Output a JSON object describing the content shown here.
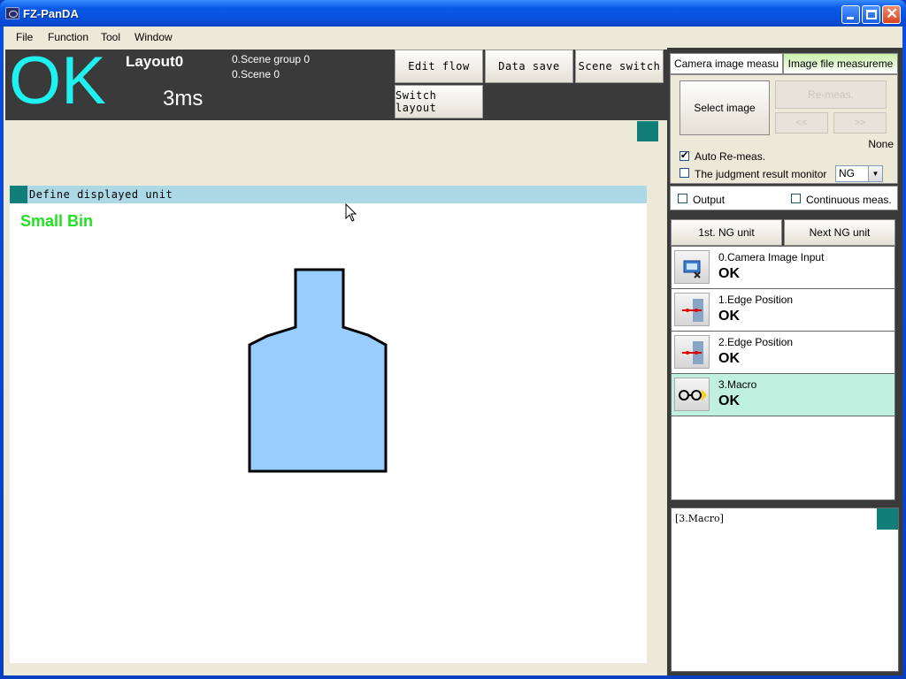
{
  "window": {
    "title": "FZ-PanDA"
  },
  "menu": [
    "File",
    "Function",
    "Tool",
    "Window"
  ],
  "header": {
    "judgement": "OK",
    "layout_name": "Layout0",
    "processing_time": "3ms",
    "scene_group": "0.Scene group 0",
    "scene": "0.Scene 0",
    "buttons": {
      "edit_flow": "Edit flow",
      "data_save": "Data save",
      "scene_switch": "Scene switch",
      "switch_layout": "Switch layout"
    }
  },
  "image_area": {
    "unit_bar_label": "Define displayed unit",
    "canvas_label": "Small Bin",
    "shape_fill": "#99ccff"
  },
  "right_panel": {
    "tabs": [
      "Camera image measu",
      "Image file measureme"
    ],
    "select_image": "Select image",
    "remeas": "Re-meas.",
    "prev": "<<",
    "next": ">>",
    "file_none": "None",
    "auto_remeas": {
      "label": "Auto Re-meas.",
      "checked": true
    },
    "judgment_monitor": {
      "label": "The judgment result monitor",
      "checked": false,
      "value": "NG"
    },
    "output": {
      "label": "Output",
      "checked": false
    },
    "continuous": {
      "label": "Continuous meas.",
      "checked": false
    },
    "first_ng": "1st. NG unit",
    "next_ng": "Next NG unit",
    "units": [
      {
        "name": "0.Camera Image Input",
        "status": "OK",
        "icon": "camera-input-icon"
      },
      {
        "name": "1.Edge Position",
        "status": "OK",
        "icon": "edge-position-icon"
      },
      {
        "name": "2.Edge Position",
        "status": "OK",
        "icon": "edge-position-icon"
      },
      {
        "name": "3.Macro",
        "status": "OK",
        "icon": "macro-icon"
      }
    ],
    "log_title": "[3.Macro]"
  },
  "colors": {
    "ok": "#1ff1f1",
    "label_green": "#22e022",
    "teal": "#127e7a",
    "selected_row": "#bff0e0"
  }
}
